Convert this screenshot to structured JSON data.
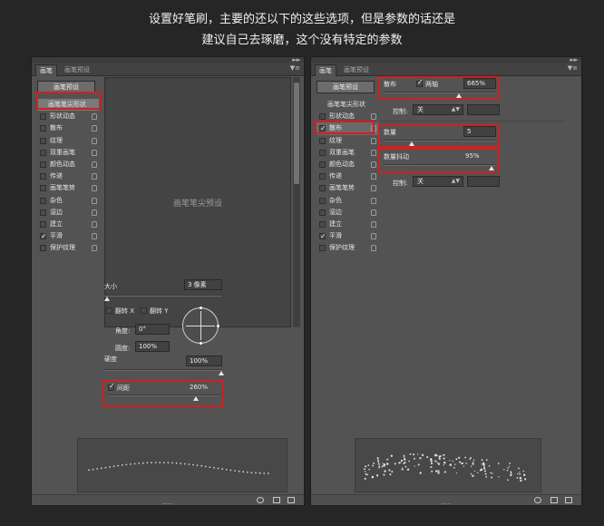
{
  "caption": {
    "line1": "设置好笔刷，主要的还以下的这些选项，但是参数的话还是",
    "line2": "建议自己去琢磨，这个没有特定的参数"
  },
  "panel_common": {
    "tab_brush": "画笔",
    "tab_presets": "画笔预设",
    "preset_button": "画笔预设",
    "brush_tip": "画笔笔尖形状"
  },
  "left_panel": {
    "options": [
      {
        "label": "形状动态",
        "checked": false,
        "locked": true
      },
      {
        "label": "散布",
        "checked": false,
        "locked": true
      },
      {
        "label": "纹理",
        "checked": false,
        "locked": true
      },
      {
        "label": "双重画笔",
        "checked": false,
        "locked": true
      },
      {
        "label": "颜色动态",
        "checked": false,
        "locked": true
      },
      {
        "label": "传递",
        "checked": false,
        "locked": true
      },
      {
        "label": "画笔笔势",
        "checked": false,
        "locked": true
      },
      {
        "label": "杂色",
        "checked": false,
        "locked": true
      },
      {
        "label": "湿边",
        "checked": false,
        "locked": true
      },
      {
        "label": "建立",
        "checked": false,
        "locked": true
      },
      {
        "label": "平滑",
        "checked": true,
        "locked": true
      },
      {
        "label": "保护纹理",
        "checked": false,
        "locked": true
      }
    ],
    "brush_grid_placeholder": "画笔笔尖预设",
    "size_label": "大小",
    "size_value": "3 像素",
    "flip_x": "翻转 X",
    "flip_y": "翻转 Y",
    "angle_label": "角度:",
    "angle_value": "0°",
    "roundness_label": "圆度:",
    "roundness_value": "100%",
    "hardness_label": "硬度",
    "hardness_value": "100%",
    "spacing_checked": true,
    "spacing_label": "间距",
    "spacing_value": "260%"
  },
  "right_panel": {
    "options": [
      {
        "label": "形状动态",
        "checked": false,
        "locked": true
      },
      {
        "label": "散布",
        "checked": true,
        "locked": true
      },
      {
        "label": "纹理",
        "checked": false,
        "locked": true
      },
      {
        "label": "双重画笔",
        "checked": false,
        "locked": true
      },
      {
        "label": "颜色动态",
        "checked": false,
        "locked": true
      },
      {
        "label": "传递",
        "checked": false,
        "locked": true
      },
      {
        "label": "画笔笔势",
        "checked": false,
        "locked": true
      },
      {
        "label": "杂色",
        "checked": false,
        "locked": true
      },
      {
        "label": "湿边",
        "checked": false,
        "locked": true
      },
      {
        "label": "建立",
        "checked": false,
        "locked": true
      },
      {
        "label": "平滑",
        "checked": true,
        "locked": true
      },
      {
        "label": "保护纹理",
        "checked": false,
        "locked": true
      }
    ],
    "scatter_label": "散布",
    "both_axes_checked": true,
    "both_axes_label": "两轴",
    "scatter_value": "665%",
    "control_label": "控制:",
    "control_value": "关",
    "count_label": "数量",
    "count_value": "5",
    "count_jitter_label": "数量抖动",
    "count_jitter_value": "95%",
    "control2_label": "控制:",
    "control2_value": "关"
  },
  "colors": {
    "highlight": "#d21f1f",
    "panel": "#535353",
    "background": "#262626"
  }
}
